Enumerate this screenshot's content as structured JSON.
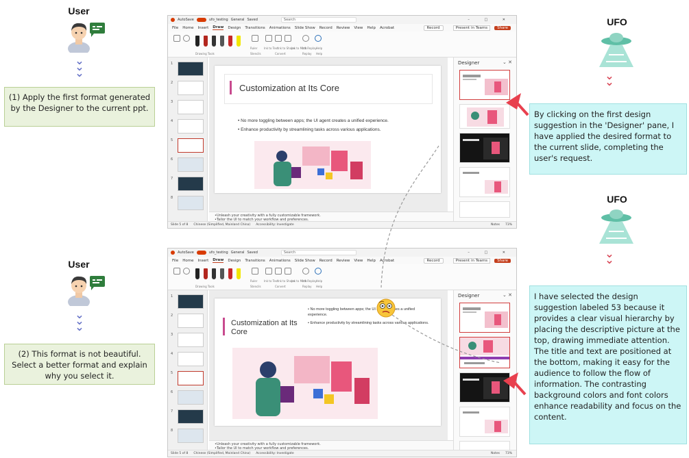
{
  "step1": {
    "user_label": "User",
    "user_request": "(1) Apply the first format generated by the  Designer to the current ppt.",
    "ufo_label": "UFO",
    "ufo_response": "By clicking on the first design suggestion in the 'Designer' pane, I have applied the desired format to the current slide, completing the user's request."
  },
  "step2": {
    "user_label": "User",
    "user_request": "(2) This format is not beautiful. Select a better format and explain why you select it.",
    "ufo_label": "UFO",
    "ufo_response": "I have selected the design suggestion labeled 53 because it provides a clear visual hierarchy by placing the descriptive picture at the top, drawing immediate attention. The title and text are positioned at the bottom, making it easy for the audience to follow the flow of information. The contrasting background colors and font colors enhance readability and focus on the content."
  },
  "ppt": {
    "autosave": "AutoSave",
    "toggle": "On",
    "filename": "ufo_testing",
    "general": "General",
    "saved": "Saved",
    "search": "Search",
    "menu": [
      "File",
      "Home",
      "Insert",
      "Draw",
      "Design",
      "Transitions",
      "Animations",
      "Slide Show",
      "Record",
      "Review",
      "View",
      "Help",
      "Acrobat"
    ],
    "active_menu": "Draw",
    "record": "Record",
    "present": "Present in Teams",
    "share": "Share",
    "ribbon_groups": [
      "Drawing Tools",
      "Stencils",
      "Convert",
      "Replay",
      "Help"
    ],
    "ribbon_tools": [
      "Ruler",
      "Ink to Text",
      "Ink to Shape",
      "Ink to Math",
      "Ink Replay",
      "Help"
    ],
    "designer_title": "Designer",
    "slide_title_1": "Customization at Its Core",
    "slide_title_2": "Customization at Its Core",
    "bullets": [
      "No more toggling between apps; the UI agent creates a unified experience.",
      "Enhance productivity by streamlining tasks across various applications."
    ],
    "notes": [
      "Unleash your creativity with a fully customizable framework.",
      "Tailor the UI to match your workflow and preferences."
    ],
    "status_slide_1": "Slide 5 of 8",
    "status_slide_2": "Slide 5 of 8",
    "status_lang": "Chinese (Simplified, Mainland China)",
    "status_access": "Accessibility: Investigate",
    "status_notes": "Notes",
    "zoom": "73%",
    "thumb_numbers": [
      "1",
      "2",
      "3",
      "4",
      "5",
      "6",
      "7",
      "8"
    ]
  },
  "colors": {
    "user_box_bg": "#eaf2dd",
    "ufo_box_bg": "#cdf6f6",
    "accent_red": "#d13b3b",
    "chevron_blue": "#6a76c9",
    "chevron_red": "#d94b5a",
    "title_bar": "#c84a8e"
  }
}
